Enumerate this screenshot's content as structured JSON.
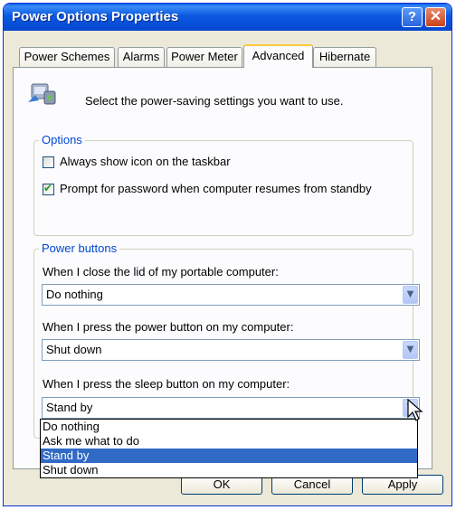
{
  "window": {
    "title": "Power Options Properties"
  },
  "titlebar_buttons": {
    "help": "?",
    "close": "✕"
  },
  "tabs": [
    {
      "label": "Power Schemes",
      "active": false
    },
    {
      "label": "Alarms",
      "active": false
    },
    {
      "label": "Power Meter",
      "active": false
    },
    {
      "label": "Advanced",
      "active": true
    },
    {
      "label": "Hibernate",
      "active": false
    }
  ],
  "header": {
    "description": "Select the power-saving settings you want to use.",
    "icon": "power-settings-icon"
  },
  "options": {
    "group_title": "Options",
    "items": [
      {
        "label": "Always show icon on the taskbar",
        "checked": false
      },
      {
        "label": "Prompt for password when computer resumes from standby",
        "checked": true
      }
    ]
  },
  "power_buttons": {
    "group_title": "Power buttons",
    "lid": {
      "label": "When I close the lid of my portable computer:",
      "value": "Do nothing"
    },
    "power": {
      "label": "When I press the power button on my computer:",
      "value": "Shut down"
    },
    "sleep": {
      "label": "When I press the sleep button on my computer:",
      "value": "Stand by"
    }
  },
  "dropdown": {
    "options": [
      "Do nothing",
      "Ask me what to do",
      "Stand by",
      "Shut down"
    ],
    "highlighted": "Stand by"
  },
  "buttons": {
    "ok": "OK",
    "cancel": "Cancel",
    "apply": "Apply"
  },
  "colors": {
    "title_bar": "#0a5fe8",
    "group_title": "#0046d5",
    "selection": "#316ac5",
    "active_tab_accent": "#ffc83c"
  }
}
